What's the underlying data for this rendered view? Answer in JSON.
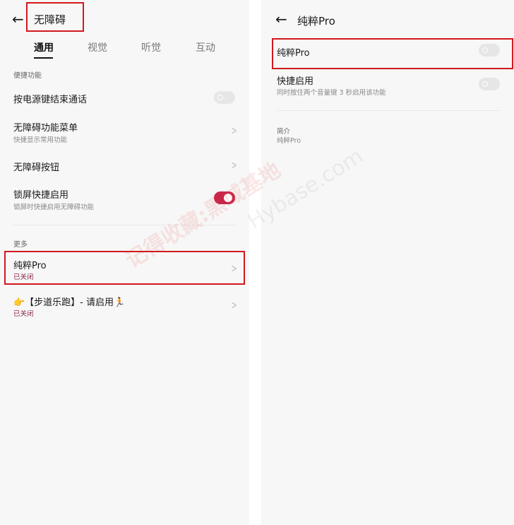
{
  "left": {
    "title": "无障碍",
    "tabs": [
      {
        "label": "通用",
        "active": true
      },
      {
        "label": "视觉"
      },
      {
        "label": "听觉"
      },
      {
        "label": "互动"
      }
    ],
    "section1": "便捷功能",
    "items": [
      {
        "title": "按电源键结束通话",
        "toggle": false
      },
      {
        "title": "无障碍功能菜单",
        "subtitle": "快捷显示常用功能"
      },
      {
        "title": "无障碍按钮"
      },
      {
        "title": "锁屏快捷启用",
        "subtitle": "锁屏时快捷启用无障碍功能",
        "toggle": true
      }
    ],
    "section2": "更多",
    "more": [
      {
        "title": "纯粹Pro",
        "subtitle": "已关闭"
      },
      {
        "title": "👉【步道乐跑】- 请启用🏃",
        "subtitle": "已关闭"
      }
    ]
  },
  "right": {
    "title": "纯粹Pro",
    "items": [
      {
        "title": "纯粹Pro",
        "toggle": false
      },
      {
        "title": "快捷启用",
        "subtitle": "同时按住两个音量键 3 秒启用该功能",
        "toggle": false
      }
    ],
    "intro_label": "简介",
    "intro_value": "纯粹Pro"
  },
  "watermark": {
    "cn": "记得收藏:黑域基地",
    "en": "Hybase.com"
  },
  "colors": {
    "accent": "#c8274a",
    "highlight_box": "#d0191e",
    "status_off": "#8a2a4a"
  }
}
